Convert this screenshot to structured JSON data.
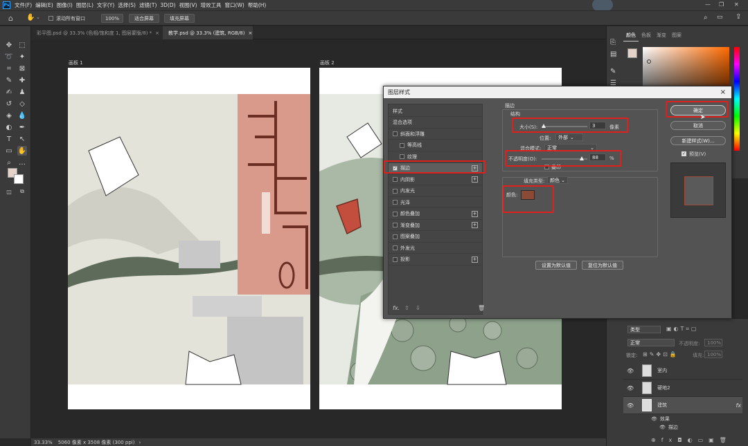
{
  "menu": {
    "items": [
      "文件(F)",
      "编辑(E)",
      "图像(I)",
      "图层(L)",
      "文字(Y)",
      "选择(S)",
      "滤镜(T)",
      "3D(D)",
      "视图(V)",
      "增效工具",
      "窗口(W)",
      "帮助(H)"
    ]
  },
  "options_bar": {
    "scroll_all_windows": "滚动所有窗口",
    "zoom_value": "100%",
    "fit_screen": "适合屏幕",
    "fill_screen": "填充屏幕"
  },
  "tabs": [
    {
      "label": "彩平图.psd @ 33.3% (色相/饱和度 1, 图层蒙版/8) *",
      "active": false
    },
    {
      "label": "教学.psd @ 33.3% (建筑, RGB/8)",
      "active": true
    }
  ],
  "canvas": {
    "artboard1": "画板 1",
    "artboard2": "画板 2"
  },
  "status": {
    "zoom": "33.33%",
    "doc_info": "5060 像素 x 3508 像素 (300 ppi)"
  },
  "color_panel": {
    "tabs": [
      "颜色",
      "色板",
      "渐变",
      "图案"
    ]
  },
  "dialog": {
    "title": "图层样式",
    "styles": [
      {
        "label": "样式",
        "checkbox": false,
        "plus": false,
        "checked": false,
        "indent": false
      },
      {
        "label": "混合选项",
        "checkbox": false,
        "plus": false,
        "checked": false,
        "indent": false
      },
      {
        "label": "斜面和浮雕",
        "checkbox": true,
        "plus": false,
        "checked": false,
        "indent": false
      },
      {
        "label": "等高线",
        "checkbox": true,
        "plus": false,
        "checked": false,
        "indent": true
      },
      {
        "label": "纹理",
        "checkbox": true,
        "plus": false,
        "checked": false,
        "indent": true
      },
      {
        "label": "描边",
        "checkbox": true,
        "plus": true,
        "checked": true,
        "indent": false
      },
      {
        "label": "内阴影",
        "checkbox": true,
        "plus": true,
        "checked": false,
        "indent": false
      },
      {
        "label": "内发光",
        "checkbox": true,
        "plus": false,
        "checked": false,
        "indent": false
      },
      {
        "label": "光泽",
        "checkbox": true,
        "plus": false,
        "checked": false,
        "indent": false
      },
      {
        "label": "颜色叠加",
        "checkbox": true,
        "plus": true,
        "checked": false,
        "indent": false
      },
      {
        "label": "渐变叠加",
        "checkbox": true,
        "plus": true,
        "checked": false,
        "indent": false
      },
      {
        "label": "图案叠加",
        "checkbox": true,
        "plus": false,
        "checked": false,
        "indent": false
      },
      {
        "label": "外发光",
        "checkbox": true,
        "plus": false,
        "checked": false,
        "indent": false
      },
      {
        "label": "投影",
        "checkbox": true,
        "plus": true,
        "checked": false,
        "indent": false
      }
    ],
    "stroke": {
      "section": "描边",
      "structure": "结构",
      "size_label": "大小(S):",
      "size_value": "3",
      "size_unit": "像素",
      "size_fraction": 0.04,
      "position_label": "位置:",
      "position_value": "外部",
      "blend_label": "混合模式:",
      "blend_value": "正常",
      "opacity_label": "不透明度(O):",
      "opacity_value": "88",
      "opacity_unit": "%",
      "opacity_fraction": 0.88,
      "overprint": "叠印",
      "fill_type_label": "填充类型:",
      "fill_type_value": "颜色",
      "color_label": "颜色:",
      "color_hex": "#8a4a36",
      "set_default": "设置为默认值",
      "reset_default": "复位为默认值"
    },
    "buttons": {
      "ok": "确定",
      "cancel": "取消",
      "new_style": "新建样式(W)...",
      "preview": "预览(V)"
    }
  },
  "layers_panel": {
    "search_placeholder": "类型",
    "blend_mode": "正常",
    "opacity_label": "不透明度:",
    "opacity_value": "100%",
    "lock_label": "锁定:",
    "fill_label": "填充:",
    "fill_value": "100%",
    "layers": [
      {
        "name": "室内",
        "selected": false
      },
      {
        "name": "硬地2",
        "selected": false
      },
      {
        "name": "建筑",
        "selected": true
      }
    ],
    "effects_label": "效果",
    "stroke_effect": "描边"
  }
}
